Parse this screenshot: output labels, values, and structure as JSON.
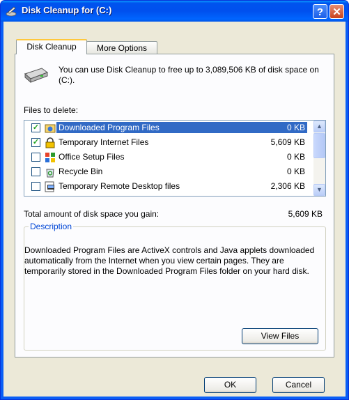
{
  "window": {
    "title": "Disk Cleanup for  (C:)",
    "help_label": "?",
    "close_label": "✕"
  },
  "tabs": [
    {
      "label": "Disk Cleanup",
      "active": true
    },
    {
      "label": "More Options",
      "active": false
    }
  ],
  "info_text": "You can use Disk Cleanup to free up to 3,089,506 KB of disk space on  (C:).",
  "files_label": "Files to delete:",
  "files": [
    {
      "label": "Downloaded Program Files",
      "size": "0 KB",
      "checked": true,
      "selected": true,
      "icon": "downloaded-files-icon"
    },
    {
      "label": "Temporary Internet Files",
      "size": "5,609 KB",
      "checked": true,
      "selected": false,
      "icon": "lock-icon"
    },
    {
      "label": "Office Setup Files",
      "size": "0 KB",
      "checked": false,
      "selected": false,
      "icon": "office-icon"
    },
    {
      "label": "Recycle Bin",
      "size": "0 KB",
      "checked": false,
      "selected": false,
      "icon": "recycle-bin-icon"
    },
    {
      "label": "Temporary Remote Desktop files",
      "size": "2,306 KB",
      "checked": false,
      "selected": false,
      "icon": "remote-desktop-icon"
    }
  ],
  "total": {
    "label": "Total amount of disk space you gain:",
    "value": "5,609 KB"
  },
  "description": {
    "title": "Description",
    "text": "Downloaded Program Files are ActiveX controls and Java applets downloaded automatically from the Internet when you view certain pages. They are temporarily stored in the Downloaded Program Files folder on your hard disk."
  },
  "buttons": {
    "view_files": "View Files",
    "ok": "OK",
    "cancel": "Cancel"
  },
  "colors": {
    "title_bar": "#0054e3",
    "selection": "#316ac5",
    "group_title": "#0046d5"
  }
}
